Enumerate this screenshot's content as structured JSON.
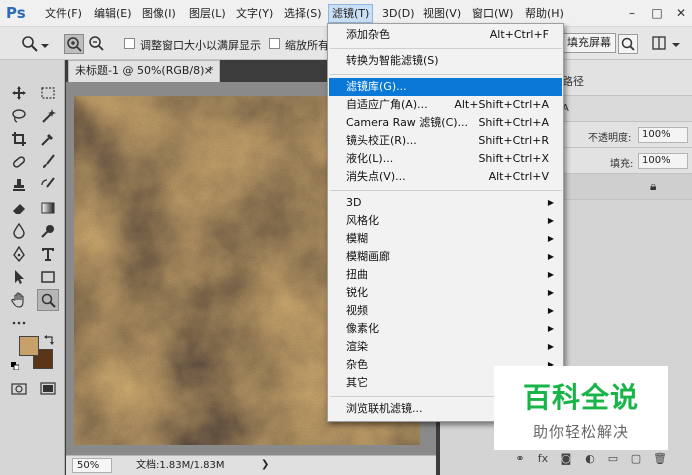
{
  "app": {
    "logo": "Ps"
  },
  "menubar": {
    "items": [
      "文件(F)",
      "编辑(E)",
      "图像(I)",
      "图层(L)",
      "文字(Y)",
      "选择(S)",
      "滤镜(T)",
      "3D(D)",
      "视图(V)",
      "窗口(W)",
      "帮助(H)"
    ],
    "active": "滤镜(T)"
  },
  "window_controls": {
    "minimize": "–",
    "restore": "□",
    "close": "✕"
  },
  "options": {
    "resize_windows_label": "调整窗口大小以满屏显示",
    "zoom_all_label": "缩放所有",
    "fill_screen_button": "填充屏幕"
  },
  "document": {
    "tab_title": "未标题-1 @ 50%(RGB/8) *",
    "zoom": "50%",
    "doc_info": "文档:1.83M/1.83M"
  },
  "right_panel": {
    "tab_label": "路径",
    "mode_label": "A",
    "opacity_label": "不透明度:",
    "opacity_value": "100%",
    "fill_label": "填充:",
    "fill_value": "100%"
  },
  "filter_menu": {
    "items": [
      {
        "label": "添加杂色",
        "shortcut": "Alt+Ctrl+F"
      },
      {
        "label": "转换为智能滤镜(S)",
        "shortcut": ""
      },
      {
        "label": "滤镜库(G)...",
        "shortcut": "",
        "highlighted": true
      },
      {
        "label": "自适应广角(A)...",
        "shortcut": "Alt+Shift+Ctrl+A"
      },
      {
        "label": "Camera Raw 滤镜(C)...",
        "shortcut": "Shift+Ctrl+A"
      },
      {
        "label": "镜头校正(R)...",
        "shortcut": "Shift+Ctrl+R"
      },
      {
        "label": "液化(L)...",
        "shortcut": "Shift+Ctrl+X"
      },
      {
        "label": "消失点(V)...",
        "shortcut": "Alt+Ctrl+V"
      },
      {
        "label": "3D",
        "submenu": true
      },
      {
        "label": "风格化",
        "submenu": true
      },
      {
        "label": "模糊",
        "submenu": true
      },
      {
        "label": "模糊画廊",
        "submenu": true
      },
      {
        "label": "扭曲",
        "submenu": true
      },
      {
        "label": "锐化",
        "submenu": true
      },
      {
        "label": "视频",
        "submenu": true
      },
      {
        "label": "像素化",
        "submenu": true
      },
      {
        "label": "渲染",
        "submenu": true
      },
      {
        "label": "杂色",
        "submenu": true
      },
      {
        "label": "其它",
        "submenu": true
      },
      {
        "label": "浏览联机滤镜...",
        "shortcut": ""
      }
    ]
  },
  "colors": {
    "foreground": "#c8a06a",
    "background": "#5a3414",
    "accent": "#0a78d7",
    "watermark": "#17b548"
  },
  "watermark": {
    "title": "百科全说",
    "subtitle": "助你轻松解决"
  }
}
